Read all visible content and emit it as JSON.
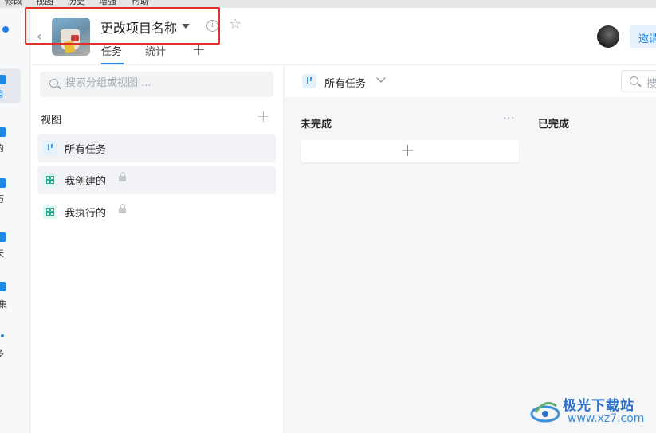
{
  "menubar": {
    "items": [
      "修改",
      "视图",
      "历史",
      "增强",
      "帮助"
    ]
  },
  "rail": {
    "items": [
      {
        "label": "目",
        "active": true
      },
      {
        "label": "的",
        "active": false
      },
      {
        "label": "历",
        "active": false
      },
      {
        "label": "天",
        "active": false
      },
      {
        "label": "集",
        "active": false
      },
      {
        "label": "多",
        "active": false
      }
    ]
  },
  "header": {
    "project_title": "更改项目名称",
    "tabs": [
      {
        "label": "任务",
        "active": true
      },
      {
        "label": "统计",
        "active": false
      }
    ],
    "invite_label": "邀请"
  },
  "sidebar": {
    "search_placeholder": "搜索分组或视图 ...",
    "section_title": "视图",
    "views": [
      {
        "label": "所有任务",
        "icon": "kanban-icon",
        "locked": false,
        "active": true
      },
      {
        "label": "我创建的",
        "icon": "table-icon",
        "locked": true,
        "active": false
      },
      {
        "label": "我执行的",
        "icon": "table-icon",
        "locked": true,
        "active": false
      }
    ]
  },
  "board": {
    "current_view": "所有任务",
    "search_placeholder": "搜索",
    "columns": [
      {
        "title": "未完成",
        "more": "···",
        "add_symbol": "+"
      },
      {
        "title": "已完成"
      }
    ]
  },
  "watermark": {
    "title": "极光下载站",
    "url": "www.xz7.com"
  },
  "colors": {
    "accent": "#1e88e5",
    "highlight_box": "#e0302b"
  }
}
